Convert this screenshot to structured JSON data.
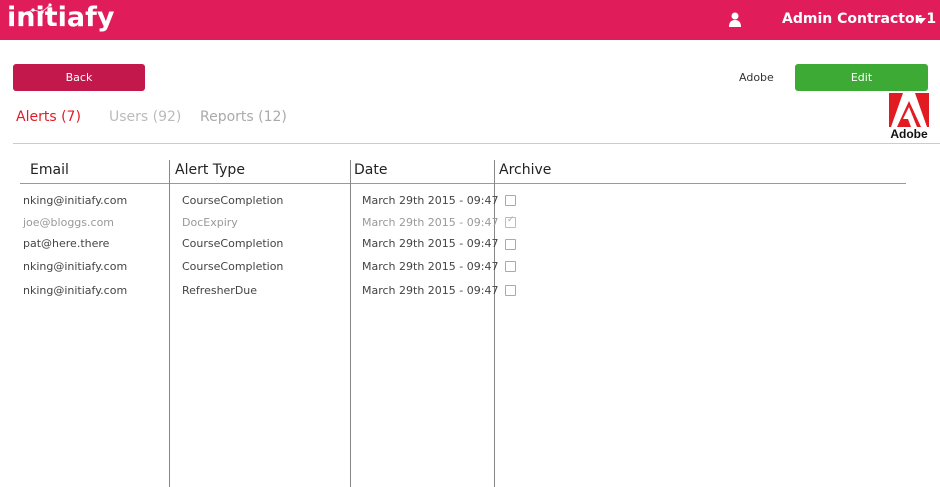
{
  "header": {
    "logo_text": "initiafy",
    "user_name": "Admin Contractor 1",
    "brand_color": "#e01c5b"
  },
  "toolbar": {
    "back_label": "Back",
    "company_name": "Adobe",
    "edit_label": "Edit",
    "company_logo_text": "Adobe"
  },
  "tabs": [
    {
      "label": "Alerts (7)",
      "active": true
    },
    {
      "label": "Users (92)",
      "active": false
    },
    {
      "label": "Reports (12)",
      "active": false
    }
  ],
  "table": {
    "columns": [
      "Email",
      "Alert Type",
      "Date",
      "Archive"
    ],
    "rows": [
      {
        "email": "nking@initiafy.com",
        "type": "CourseCompletion",
        "date": "March 29th 2015 - 09:47",
        "archived": false
      },
      {
        "email": "joe@bloggs.com",
        "type": "DocExpiry",
        "date": "March 29th 2015 - 09:47",
        "archived": true
      },
      {
        "email": "pat@here.there",
        "type": "CourseCompletion",
        "date": "March 29th 2015 - 09:47",
        "archived": false
      },
      {
        "email": "nking@initiafy.com",
        "type": "CourseCompletion",
        "date": "March 29th 2015 - 09:47",
        "archived": false
      },
      {
        "email": "nking@initiafy.com",
        "type": "RefresherDue",
        "date": "March 29th 2015 - 09:47",
        "archived": false
      }
    ]
  }
}
